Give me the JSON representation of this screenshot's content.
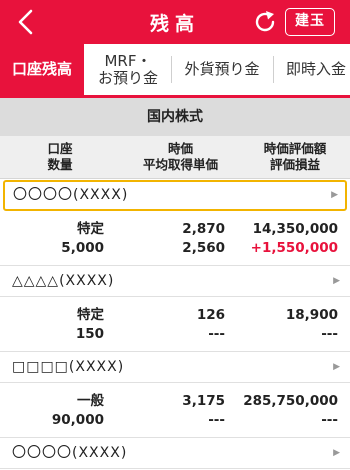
{
  "header": {
    "title": "残高",
    "kendama_label": "建玉"
  },
  "tabs": [
    {
      "label": "口座残高",
      "active": true
    },
    {
      "label": "MRF・\nお預り金",
      "active": false
    },
    {
      "label": "外貨預り金",
      "active": false
    },
    {
      "label": "即時入金",
      "active": false
    }
  ],
  "section": {
    "title": "国内株式"
  },
  "columns": {
    "account": "口座",
    "quantity": "数量",
    "price": "時価",
    "avg_cost": "平均取得単価",
    "market_value": "時価評価額",
    "pnl": "評価損益"
  },
  "holdings": [
    {
      "name": "〇〇〇〇(XXXX)",
      "account": "特定",
      "quantity": "5,000",
      "price": "2,870",
      "avg_cost": "2,560",
      "market_value": "14,350,000",
      "pnl": "+1,550,000"
    },
    {
      "name": "△△△△(XXXX)",
      "account": "特定",
      "quantity": "150",
      "price": "126",
      "avg_cost": "---",
      "market_value": "18,900",
      "pnl": "---"
    },
    {
      "name": "□□□□(XXXX)",
      "account": "一般",
      "quantity": "90,000",
      "price": "3,175",
      "avg_cost": "---",
      "market_value": "285,750,000",
      "pnl": "---"
    },
    {
      "name": "〇〇〇〇(XXXX)"
    }
  ],
  "colors": {
    "accent": "#e8123c",
    "highlight": "#f2b400"
  },
  "icons": {
    "back": "chevron-left-icon",
    "refresh": "refresh-icon",
    "row_arrow": "triangle-right-icon"
  }
}
